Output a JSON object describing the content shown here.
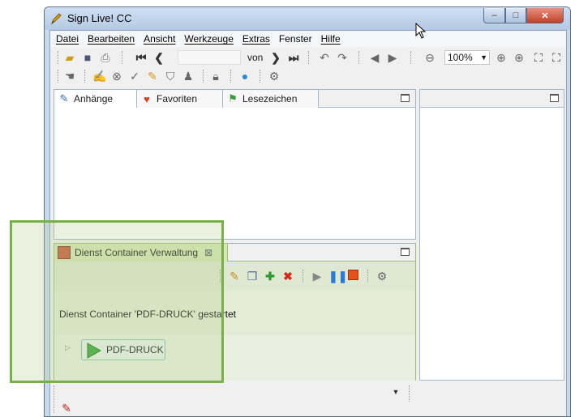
{
  "window": {
    "title": "Sign Live! CC",
    "icon": "pen-nib-icon",
    "controls": {
      "minimize": "–",
      "maximize": "□",
      "close": "✕"
    }
  },
  "menu": [
    "Datei",
    "Bearbeiten",
    "Ansicht",
    "Werkzeuge",
    "Extras",
    "Fenster",
    "Hilfe"
  ],
  "toolbar": {
    "page_input": "",
    "von_label": "von",
    "zoom": "100%"
  },
  "left_panel": {
    "tabs": [
      {
        "label": "Anhänge",
        "icon": "paperclip-icon"
      },
      {
        "label": "Favoriten",
        "icon": "heart-icon"
      },
      {
        "label": "Lesezeichen",
        "icon": "bookmark-icon"
      }
    ]
  },
  "service_panel": {
    "tab_label": "Dienst Container Verwaltung",
    "tab_close": "⊠",
    "status": "Dienst Container 'PDF-DRUCK' gestartet",
    "items": [
      {
        "label": "PDF-DRUCK",
        "state": "running"
      }
    ]
  },
  "colors": {
    "highlight": "#7ab04a",
    "panel_border": "#a8b5c6",
    "close_button": "#c0412a"
  }
}
